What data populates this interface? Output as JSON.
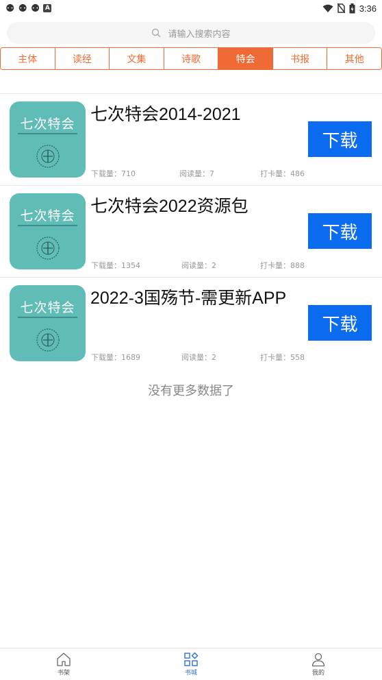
{
  "status_bar": {
    "time": "3:36",
    "left_icons": [
      "bug-icon",
      "bug-icon",
      "bug-icon",
      "a-icon"
    ],
    "a_text": "A"
  },
  "search": {
    "placeholder": "请输入搜索内容"
  },
  "tabs": [
    {
      "label": "主体",
      "active": false
    },
    {
      "label": "读经",
      "active": false
    },
    {
      "label": "文集",
      "active": false
    },
    {
      "label": "诗歌",
      "active": false
    },
    {
      "label": "特会",
      "active": true
    },
    {
      "label": "书报",
      "active": false
    },
    {
      "label": "其他",
      "active": false
    }
  ],
  "cover_text": "七次特会",
  "download_label": "下载",
  "items": [
    {
      "title": "七次特会2014-2021",
      "downloads": "下载量：710",
      "reads": "阅读量：7",
      "checkins": "打卡量：486"
    },
    {
      "title": "七次特会2022资源包",
      "downloads": "下载量：1354",
      "reads": "阅读量：2",
      "checkins": "打卡量：888"
    },
    {
      "title": "2022-3国殇节-需更新APP",
      "downloads": "下载量：1689",
      "reads": "阅读量：2",
      "checkins": "打卡量：558"
    }
  ],
  "no_more": "没有更多数据了",
  "bottom_nav": [
    {
      "label": "书架",
      "icon": "home-icon",
      "active": false
    },
    {
      "label": "书城",
      "icon": "grid-icon",
      "active": true
    },
    {
      "label": "我的",
      "icon": "user-icon",
      "active": false
    }
  ],
  "colors": {
    "accent": "#f06a35",
    "download": "#0b6cf0",
    "cover": "#5fbcb7",
    "nav_active": "#2f6fd6"
  }
}
